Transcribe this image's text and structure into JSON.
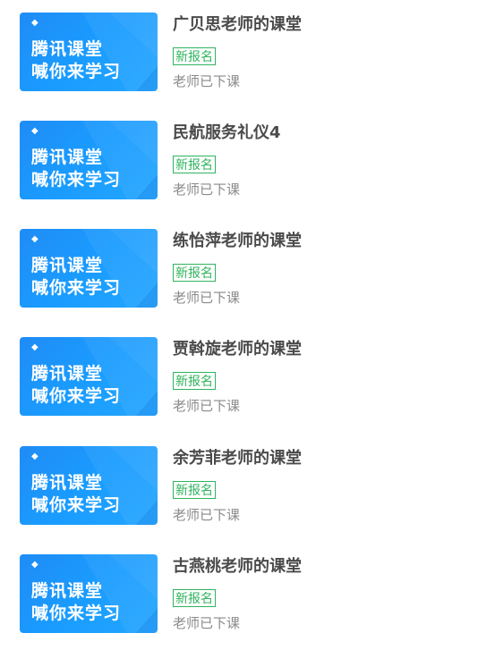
{
  "courses": [
    {
      "title": "广贝思老师的课堂",
      "badge": "新报名",
      "status": "老师已下课",
      "thumb": {
        "logo_icon": "tencent-class-logo-icon",
        "line1": "腾讯课堂",
        "line2": "喊你来学习"
      }
    },
    {
      "title": "民航服务礼仪4",
      "badge": "新报名",
      "status": "老师已下课",
      "thumb": {
        "logo_icon": "tencent-class-logo-icon",
        "line1": "腾讯课堂",
        "line2": "喊你来学习"
      }
    },
    {
      "title": "练怡萍老师的课堂",
      "badge": "新报名",
      "status": "老师已下课",
      "thumb": {
        "logo_icon": "tencent-class-logo-icon",
        "line1": "腾讯课堂",
        "line2": "喊你来学习"
      }
    },
    {
      "title": "贾斡旋老师的课堂",
      "badge": "新报名",
      "status": "老师已下课",
      "thumb": {
        "logo_icon": "tencent-class-logo-icon",
        "line1": "腾讯课堂",
        "line2": "喊你来学习"
      }
    },
    {
      "title": "余芳菲老师的课堂",
      "badge": "新报名",
      "status": "老师已下课",
      "thumb": {
        "logo_icon": "tencent-class-logo-icon",
        "line1": "腾讯课堂",
        "line2": "喊你来学习"
      }
    },
    {
      "title": "古燕桃老师的课堂",
      "badge": "新报名",
      "status": "老师已下课",
      "thumb": {
        "logo_icon": "tencent-class-logo-icon",
        "line1": "腾讯课堂",
        "line2": "喊你来学习"
      }
    }
  ],
  "colors": {
    "thumb_blue": "#1a9cff",
    "badge_green": "#2fb45d",
    "title_text": "#4a4a4a",
    "status_text": "#8a8a8a"
  }
}
